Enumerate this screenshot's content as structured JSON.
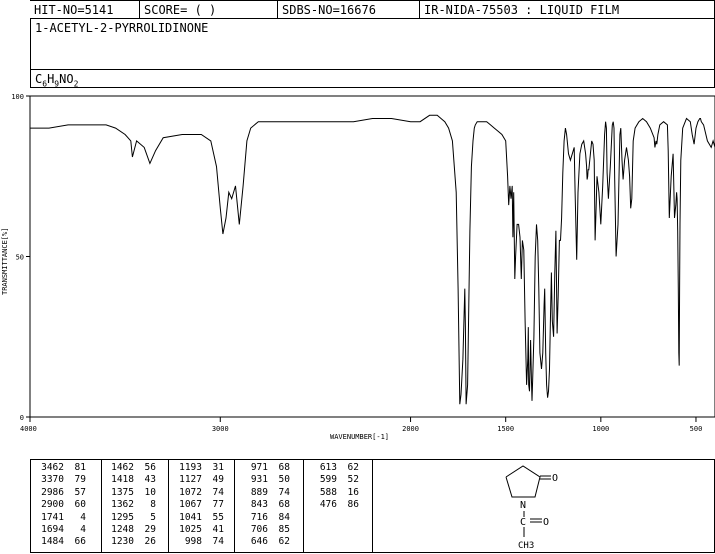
{
  "header": {
    "hit_no": "HIT-NO=5141",
    "score": "SCORE=  (   )",
    "sdbs_no": "SDBS-NO=16676",
    "ir_code": "IR-NIDA-75503 : LIQUID FILM"
  },
  "compound_name": "1-ACETYL-2-PYRROLIDINONE",
  "formula": {
    "c": "C",
    "c_n": "6",
    "h": "H",
    "h_n": "9",
    "rest": "NO",
    "o_n": "2"
  },
  "structure": {
    "o_label": "O",
    "n_label": "N",
    "c_label": "C",
    "methyl_label": "CH3"
  },
  "chart_data": {
    "type": "line",
    "xlabel": "WAVENUMBER[-1]",
    "ylabel": "TRANSMITTANCE[%]",
    "xlim": [
      4000,
      400
    ],
    "ylim": [
      0,
      100
    ],
    "xticks": [
      4000,
      3000,
      2000,
      1500,
      1000,
      500
    ],
    "yticks": [
      0,
      50,
      100
    ],
    "series": [
      {
        "x": [
          4000,
          3900,
          3800,
          3700,
          3600,
          3550,
          3500,
          3470,
          3462,
          3440,
          3400,
          3370,
          3340,
          3300,
          3200,
          3100,
          3050,
          3020,
          3000,
          2986,
          2970,
          2955,
          2940,
          2920,
          2900,
          2880,
          2860,
          2840,
          2800,
          2700,
          2600,
          2500,
          2400,
          2300,
          2200,
          2100,
          2000,
          1950,
          1900,
          1894,
          1880,
          1860,
          1840,
          1820,
          1800,
          1780,
          1760,
          1750,
          1741,
          1735,
          1725,
          1715,
          1712,
          1708,
          1700,
          1694,
          1688,
          1680,
          1672,
          1665,
          1660,
          1650,
          1640,
          1620,
          1600,
          1580,
          1560,
          1540,
          1520,
          1500,
          1490,
          1484,
          1478,
          1472,
          1466,
          1462,
          1458,
          1452,
          1448,
          1440,
          1432,
          1425,
          1418,
          1412,
          1405,
          1398,
          1390,
          1384,
          1381,
          1379,
          1375,
          1372,
          1369,
          1365,
          1362,
          1358,
          1352,
          1345,
          1338,
          1332,
          1326,
          1320,
          1312,
          1305,
          1298,
          1295,
          1290,
          1285,
          1280,
          1275,
          1270,
          1265,
          1260,
          1255,
          1248,
          1242,
          1236,
          1230,
          1224,
          1218,
          1212,
          1206,
          1200,
          1193,
          1186,
          1180,
          1170,
          1160,
          1150,
          1140,
          1135,
          1127,
          1120,
          1110,
          1100,
          1090,
          1080,
          1075,
          1072,
          1069,
          1067,
          1063,
          1055,
          1048,
          1041,
          1035,
          1030,
          1025,
          1020,
          1010,
          1000,
          990,
          980,
          975,
          971,
          967,
          960,
          950,
          940,
          935,
          931,
          927,
          920,
          910,
          900,
          895,
          889,
          883,
          875,
          865,
          855,
          849,
          843,
          837,
          830,
          820,
          800,
          780,
          760,
          740,
          720,
          716,
          710,
          706,
          700,
          690,
          670,
          650,
          646,
          640,
          630,
          620,
          613,
          606,
          602,
          599,
          596,
          593,
          590,
          588,
          586,
          584,
          580,
          570,
          550,
          530,
          520,
          510,
          500,
          490,
          480,
          476,
          472,
          460,
          440,
          420,
          410,
          400
        ],
        "y": [
          90,
          90,
          91,
          91,
          91,
          90,
          88,
          86,
          81,
          86,
          84,
          79,
          83,
          87,
          88,
          88,
          86,
          78,
          65,
          57,
          62,
          70,
          68,
          72,
          60,
          72,
          86,
          90,
          92,
          92,
          92,
          92,
          92,
          92,
          93,
          93,
          92,
          92,
          94,
          94,
          94,
          94,
          93,
          92,
          90,
          86,
          70,
          40,
          4,
          7,
          18,
          40,
          28,
          4,
          10,
          35,
          58,
          78,
          86,
          90,
          91,
          92,
          92,
          92,
          92,
          91,
          90,
          89,
          88,
          86,
          75,
          66,
          72,
          68,
          72,
          56,
          70,
          43,
          50,
          60,
          60,
          56,
          43,
          55,
          52,
          30,
          10,
          18,
          28,
          10,
          8,
          15,
          24,
          12,
          5,
          12,
          25,
          50,
          60,
          55,
          40,
          20,
          15,
          20,
          35,
          40,
          20,
          10,
          6,
          8,
          15,
          30,
          45,
          30,
          25,
          45,
          58,
          26,
          38,
          55,
          55,
          62,
          76,
          86,
          90,
          88,
          82,
          80,
          82,
          84,
          70,
          49,
          70,
          82,
          85,
          86,
          82,
          78,
          74,
          75,
          77,
          77,
          82,
          86,
          85,
          80,
          55,
          65,
          75,
          70,
          60,
          72,
          88,
          92,
          90,
          76,
          68,
          78,
          91,
          92,
          90,
          74,
          50,
          60,
          88,
          90,
          80,
          74,
          80,
          84,
          80,
          75,
          65,
          68,
          86,
          90,
          92,
          93,
          92,
          90,
          87,
          84,
          86,
          85,
          88,
          91,
          92,
          91,
          83,
          62,
          75,
          82,
          62,
          66,
          70,
          68,
          58,
          40,
          20,
          16,
          40,
          60,
          80,
          90,
          93,
          92,
          88,
          85,
          90,
          92,
          93,
          93,
          92,
          91,
          86,
          84,
          86,
          84
        ]
      }
    ]
  },
  "peak_table": {
    "columns": [
      {
        "wn": [
          "3462",
          "3370",
          "2986",
          "2900",
          "1741",
          "1694",
          "1484"
        ],
        "t": [
          "81",
          "79",
          "57",
          "60",
          "4",
          "4",
          "66"
        ]
      },
      {
        "wn": [
          "1462",
          "1418",
          "1375",
          "1362",
          "1295",
          "1248",
          "1230"
        ],
        "t": [
          "56",
          "43",
          "10",
          "8",
          "5",
          "29",
          "26"
        ]
      },
      {
        "wn": [
          "1193",
          "1127",
          "1072",
          "1067",
          "1041",
          "1025",
          "998"
        ],
        "t": [
          "31",
          "49",
          "74",
          "77",
          "55",
          "41",
          "74"
        ]
      },
      {
        "wn": [
          "971",
          "931",
          "889",
          "843",
          "716",
          "706",
          "646"
        ],
        "t": [
          "68",
          "50",
          "74",
          "68",
          "84",
          "85",
          "62"
        ]
      },
      {
        "wn": [
          "613",
          "599",
          "588",
          "476"
        ],
        "t": [
          "62",
          "52",
          "16",
          "86"
        ]
      }
    ]
  }
}
